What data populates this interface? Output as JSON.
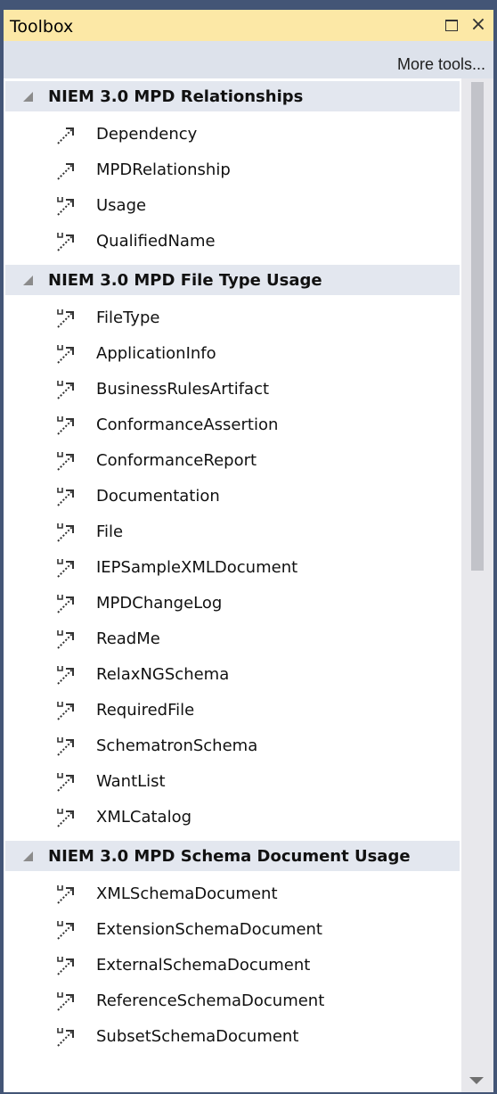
{
  "window": {
    "title": "Toolbox"
  },
  "toolbar": {
    "more_tools": "More tools..."
  },
  "groups": [
    {
      "title": "NIEM 3.0 MPD Relationships",
      "items": [
        {
          "label": "Dependency",
          "icon": "dependency-icon"
        },
        {
          "label": "MPDRelationship",
          "icon": "dependency-icon"
        },
        {
          "label": "Usage",
          "icon": "usage-icon"
        },
        {
          "label": "QualifiedName",
          "icon": "usage-icon"
        }
      ]
    },
    {
      "title": "NIEM 3.0 MPD File Type Usage",
      "items": [
        {
          "label": "FileType",
          "icon": "usage-icon"
        },
        {
          "label": "ApplicationInfo",
          "icon": "usage-icon"
        },
        {
          "label": "BusinessRulesArtifact",
          "icon": "usage-icon"
        },
        {
          "label": "ConformanceAssertion",
          "icon": "usage-icon"
        },
        {
          "label": "ConformanceReport",
          "icon": "usage-icon"
        },
        {
          "label": "Documentation",
          "icon": "usage-icon"
        },
        {
          "label": "File",
          "icon": "usage-icon"
        },
        {
          "label": "IEPSampleXMLDocument",
          "icon": "usage-icon"
        },
        {
          "label": "MPDChangeLog",
          "icon": "usage-icon"
        },
        {
          "label": "ReadMe",
          "icon": "usage-icon"
        },
        {
          "label": "RelaxNGSchema",
          "icon": "usage-icon"
        },
        {
          "label": "RequiredFile",
          "icon": "usage-icon"
        },
        {
          "label": "SchematronSchema",
          "icon": "usage-icon"
        },
        {
          "label": "WantList",
          "icon": "usage-icon"
        },
        {
          "label": "XMLCatalog",
          "icon": "usage-icon"
        }
      ]
    },
    {
      "title": "NIEM 3.0 MPD Schema Document Usage",
      "items": [
        {
          "label": "XMLSchemaDocument",
          "icon": "usage-icon"
        },
        {
          "label": "ExtensionSchemaDocument",
          "icon": "usage-icon"
        },
        {
          "label": "ExternalSchemaDocument",
          "icon": "usage-icon"
        },
        {
          "label": "ReferenceSchemaDocument",
          "icon": "usage-icon"
        },
        {
          "label": "SubsetSchemaDocument",
          "icon": "usage-icon"
        }
      ]
    }
  ]
}
